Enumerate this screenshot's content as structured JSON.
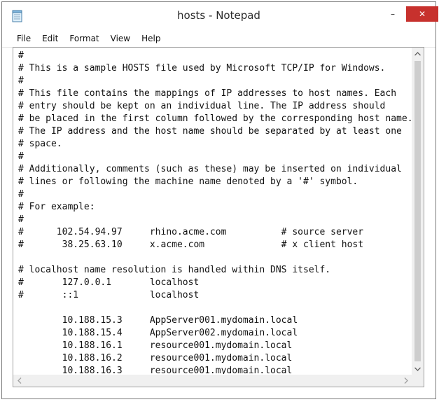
{
  "window": {
    "title": "hosts - Notepad"
  },
  "title_buttons": {
    "minimize": "–",
    "maximize": "☐",
    "close": "✕"
  },
  "menu": [
    "File",
    "Edit",
    "Format",
    "View",
    "Help"
  ],
  "editor": {
    "lines": [
      "#",
      "# This is a sample HOSTS file used by Microsoft TCP/IP for Windows.",
      "#",
      "# This file contains the mappings of IP addresses to host names. Each",
      "# entry should be kept on an individual line. The IP address should",
      "# be placed in the first column followed by the corresponding host name.",
      "# The IP address and the host name should be separated by at least one",
      "# space.",
      "#",
      "# Additionally, comments (such as these) may be inserted on individual",
      "# lines or following the machine name denoted by a '#' symbol.",
      "#",
      "# For example:",
      "#",
      "#      102.54.94.97     rhino.acme.com          # source server",
      "#       38.25.63.10     x.acme.com              # x client host",
      "",
      "# localhost name resolution is handled within DNS itself.",
      "#       127.0.0.1       localhost",
      "#       ::1             localhost",
      "",
      "        10.188.15.3     AppServer001.mydomain.local",
      "        10.188.15.4     AppServer002.mydomain.local",
      "        10.188.16.1     resource001.mydomain.local",
      "        10.188.16.2     resource001.mydomain.local",
      "        10.188.16.3     resource001.mydomain.local"
    ]
  },
  "icons": {
    "app": "notepad-icon",
    "scroll_up": "chevron-up-icon",
    "scroll_down": "chevron-down-icon",
    "scroll_left": "chevron-left-icon",
    "scroll_right": "chevron-right-icon"
  },
  "colors": {
    "close_button": "#c7312d",
    "scrollbar_track": "#f0f0f0",
    "scrollbar_thumb": "#cdcdcd"
  }
}
